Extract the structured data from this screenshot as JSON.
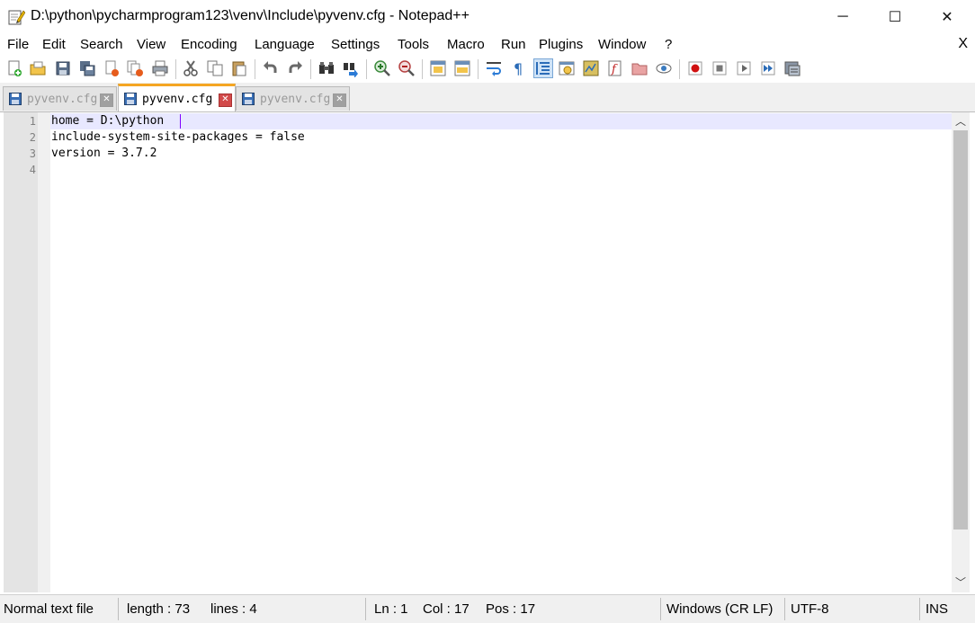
{
  "window": {
    "title": "D:\\python\\pycharmprogram123\\venv\\Include\\pyvenv.cfg - Notepad++",
    "minimize_glyph": "─",
    "maximize_glyph": "☐",
    "close_glyph": "✕"
  },
  "menu": {
    "items": [
      "File",
      "Edit",
      "Search",
      "View",
      "Encoding",
      "Language",
      "Settings",
      "Tools",
      "Macro",
      "Run",
      "Plugins",
      "Window",
      "?"
    ],
    "close_glyph": "X"
  },
  "toolbar": {
    "icons": [
      "new-file-icon",
      "open-file-icon",
      "save-icon",
      "save-all-icon",
      "close-icon",
      "close-all-icon",
      "print-icon",
      "cut-icon",
      "copy-icon",
      "paste-icon",
      "undo-icon",
      "redo-icon",
      "find-icon",
      "replace-icon",
      "zoom-in-icon",
      "zoom-out-icon",
      "sync-vertical-icon",
      "sync-horizontal-icon",
      "word-wrap-icon",
      "show-all-chars-icon",
      "indent-guide-icon",
      "user-defined-language-icon",
      "document-map-icon",
      "function-list-icon",
      "folder-as-workspace-icon",
      "monitoring-icon",
      "record-macro-icon",
      "stop-recording-icon",
      "playback-macro-icon",
      "run-macro-multiple-icon",
      "save-macro-icon"
    ]
  },
  "tabs": [
    {
      "label": "pyvenv.cfg",
      "active": false
    },
    {
      "label": "pyvenv.cfg",
      "active": true
    },
    {
      "label": "pyvenv.cfg",
      "active": false
    }
  ],
  "editor": {
    "line_numbers": [
      "1",
      "2",
      "3",
      "4"
    ],
    "lines": [
      "home = D:\\python",
      "include-system-site-packages = false",
      "version = 3.7.2",
      ""
    ],
    "current_line": 1
  },
  "status": {
    "file_type": "Normal text file",
    "length": "length : 73",
    "lines": "lines : 4",
    "ln": "Ln : 1",
    "col": "Col : 17",
    "pos": "Pos : 17",
    "eol": "Windows (CR LF)",
    "encoding": "UTF-8",
    "mode": "INS"
  },
  "colors": {
    "tab_accent": "#f5a623",
    "current_line_bg": "#e8e8ff",
    "caret": "#8000ff"
  }
}
